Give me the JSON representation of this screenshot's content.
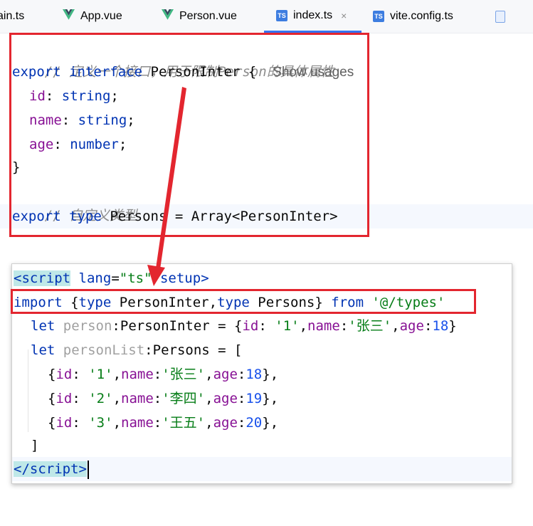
{
  "tabs": [
    {
      "label": "ain.ts",
      "icon": "ts-file-icon"
    },
    {
      "label": "App.vue",
      "icon": "vue-file-icon"
    },
    {
      "label": "Person.vue",
      "icon": "vue-file-icon"
    },
    {
      "label": "index.ts",
      "icon": "ts-file-icon",
      "active": true,
      "close": "×"
    },
    {
      "label": "vite.config.ts",
      "icon": "ts-file-icon"
    }
  ],
  "icon_text": {
    "ts": "TS"
  },
  "editor": {
    "comment1": "// 定义一个接口，用于限制Person的具体属性",
    "kw_export": "export",
    "kw_interface": "interface",
    "name_PersonInter": "PersonInter",
    "brace_open": "{",
    "show_usages": "Show usages",
    "prop_id": "id",
    "prop_name": "name",
    "prop_age": "age",
    "type_string": "string",
    "type_number": "number",
    "colon": ": ",
    "semicolon": ";",
    "brace_close": "}",
    "comment2": "// 自定义类型",
    "kw_type": "type",
    "name_Persons": "Persons",
    "type_alias_rest": " = Array<PersonInter>"
  },
  "popup": {
    "tag_open_lt": "<",
    "tag_script": "script",
    "attr_lang": "lang",
    "attr_eq": "=",
    "attr_lang_value": "\"ts\"",
    "attr_setup": "setup",
    "tag_gt": ">",
    "kw_import": "import",
    "import_open": "{",
    "kw_type": "type",
    "import_PersonInter": "PersonInter",
    "comma": ",",
    "import_Persons": "Persons",
    "import_close": "}",
    "kw_from": "from",
    "import_path": "'@/types'",
    "kw_let": "let",
    "var_person": "person",
    "var_personList": "personList",
    "type_PersonInter": "PersonInter",
    "type_Persons": "Persons",
    "assign_obj": " = {",
    "assign_arr": " = [",
    "prop_id": "id",
    "prop_name": "name",
    "prop_age": "age",
    "obj_close": "}",
    "row_close": "},",
    "arr_close": "]",
    "person": {
      "id": "'1'",
      "name": "'张三'",
      "age": "18"
    },
    "rows": [
      {
        "id": "'1'",
        "name": "'张三'",
        "age": "18"
      },
      {
        "id": "'2'",
        "name": "'李四'",
        "age": "19"
      },
      {
        "id": "'3'",
        "name": "'王五'",
        "age": "20"
      }
    ],
    "tag_close_lt": "</"
  },
  "colors": {
    "keyword": "#0033b3",
    "property": "#871094",
    "string": "#067d17",
    "number": "#1750eb",
    "comment": "#8c8c8c",
    "annotation_red": "#e3262f",
    "active_tab": "#3574f0"
  }
}
